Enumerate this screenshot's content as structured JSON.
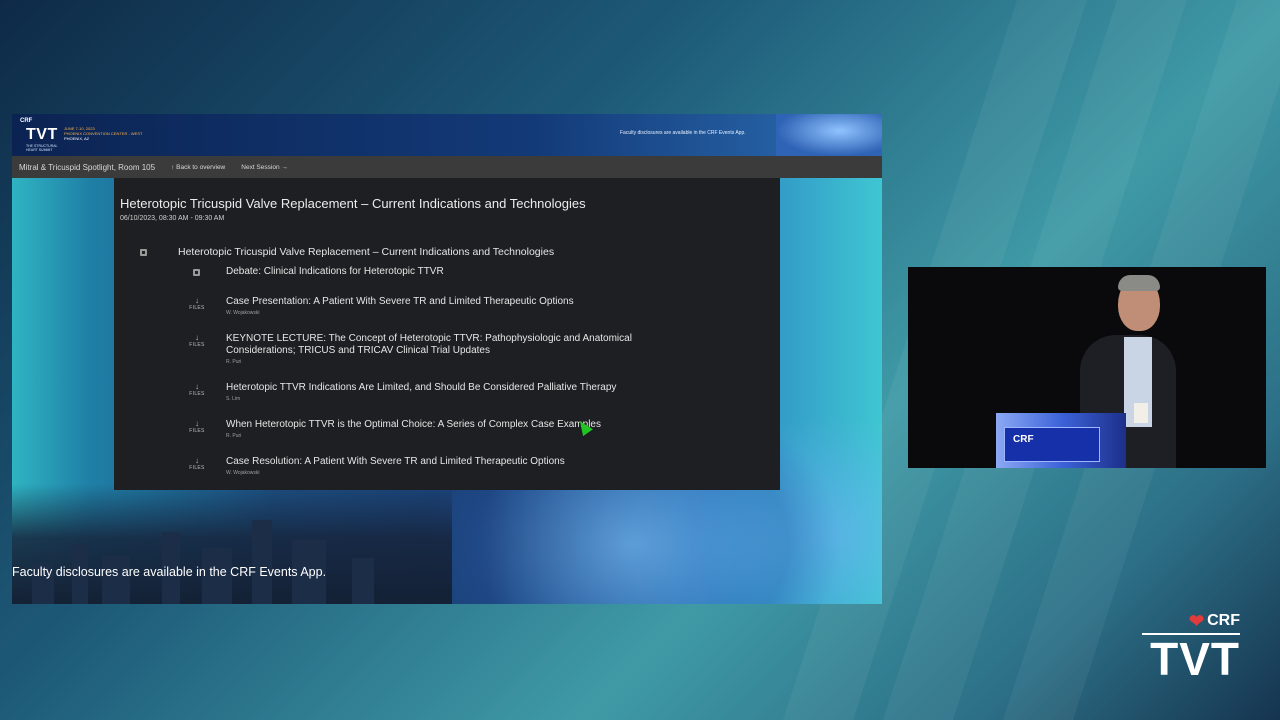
{
  "slide": {
    "header": {
      "crf": "CRF",
      "tvt": "TVT",
      "subtitle": "THE STRUCTURAL HEART SUMMIT",
      "dates": "JUNE 7-10, 2023",
      "venue": "PHOENIX CONVENTION CENTER - WEST",
      "city": "PHOENIX, AZ",
      "disclosure": "Faculty disclosures are available in the CRF Events App."
    },
    "nav": {
      "room": "Mitral & Tricuspid Spotlight, Room 105",
      "back": "Back to overview",
      "next": "Next Session"
    },
    "session": {
      "title": "Heterotopic Tricuspid Valve Replacement – Current Indications and Technologies",
      "datetime": "06/10/2023, 08:30 AM - 09:30 AM",
      "parent": "Heterotopic Tricuspid Valve Replacement – Current Indications and Technologies",
      "child": "Debate: Clinical Indications for Heterotopic TTVR",
      "files_label": "FILES",
      "items": [
        {
          "title": "Case Presentation: A Patient With Severe TR and Limited Therapeutic Options",
          "author": "W. Wojakowski"
        },
        {
          "title": "KEYNOTE LECTURE: The Concept of Heterotopic TTVR: Pathophysiologic and Anatomical Considerations; TRICUS and TRICAV Clinical Trial Updates",
          "author": "R. Puri"
        },
        {
          "title": "Heterotopic TTVR Indications Are Limited, and Should Be Considered Palliative Therapy",
          "author": "S. Lim"
        },
        {
          "title": "When Heterotopic TTVR is the Optimal Choice: A Series of Complex Case Examples",
          "author": "R. Puri"
        },
        {
          "title": "Case Resolution: A Patient With Severe TR and Limited Therapeutic Options",
          "author": "W. Wojakowski"
        }
      ]
    },
    "footer": "Faculty disclosures are available in the CRF Events App."
  },
  "camera": {
    "podium_logo": "CRF"
  },
  "brand": {
    "crf": "CRF",
    "tvt": "TVT"
  },
  "colors": {
    "accent_orange": "#ffb347",
    "cursor_green": "#22c422",
    "brand_red": "#e23b3b"
  }
}
